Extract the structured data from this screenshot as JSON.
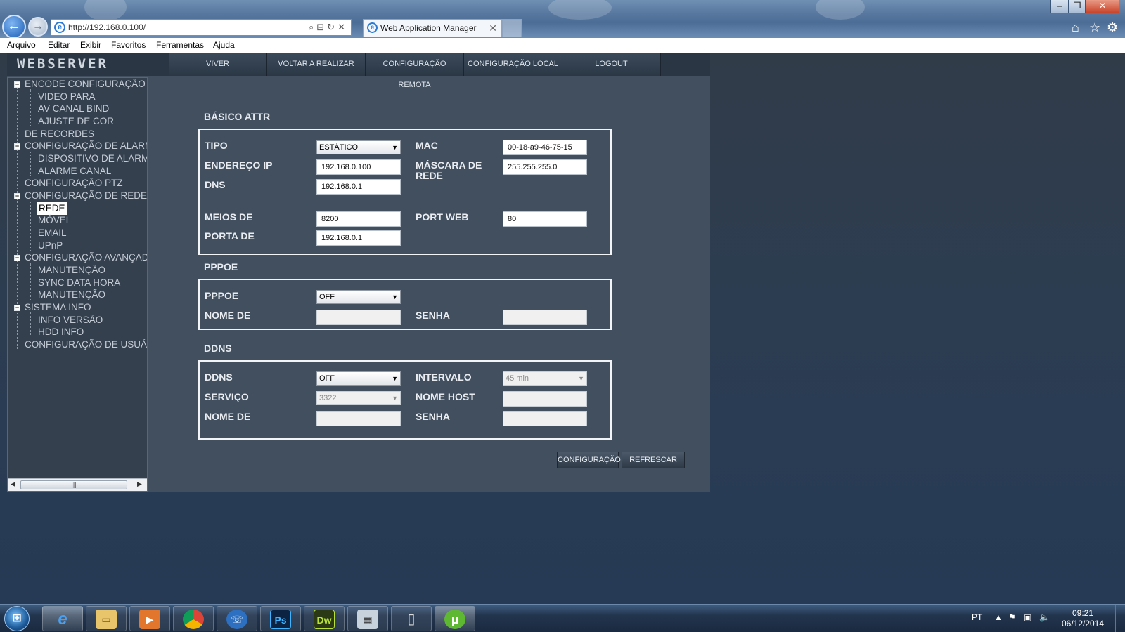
{
  "browser": {
    "address": "http://192.168.0.100/",
    "address_host": "192.168.0.100",
    "tab_title": "Web Application Manager",
    "window_controls": [
      "minimize-icon",
      "restore-icon",
      "close-icon"
    ],
    "menu": [
      "Arquivo",
      "Editar",
      "Exibir",
      "Favoritos",
      "Ferramentas",
      "Ajuda"
    ]
  },
  "app": {
    "logo": "WEBSERVER",
    "nav": [
      "VIVER",
      "VOLTAR A REALIZAR",
      "CONFIGURAÇÃO REMOTA",
      "CONFIGURAÇÃO LOCAL",
      "LOGOUT"
    ]
  },
  "tree": [
    {
      "label": "ENCODE CONFIGURAÇÃO",
      "level": 0,
      "toggle": true
    },
    {
      "label": "VIDEO PARA",
      "level": 1
    },
    {
      "label": "AV CANAL BIND",
      "level": 1
    },
    {
      "label": "AJUSTE DE COR",
      "level": 1
    },
    {
      "label": "DE RECORDES",
      "level": 0
    },
    {
      "label": "CONFIGURAÇÃO DE ALARM",
      "level": 0,
      "toggle": true
    },
    {
      "label": "DISPOSITIVO DE ALARM",
      "level": 1
    },
    {
      "label": "ALARME CANAL",
      "level": 1
    },
    {
      "label": "CONFIGURAÇÃO PTZ",
      "level": 0
    },
    {
      "label": "CONFIGURAÇÃO DE REDE",
      "level": 0,
      "toggle": true
    },
    {
      "label": "REDE",
      "level": 1,
      "selected": true
    },
    {
      "label": "MÓVEL",
      "level": 1
    },
    {
      "label": "EMAIL",
      "level": 1
    },
    {
      "label": "UPnP",
      "level": 1
    },
    {
      "label": "CONFIGURAÇÃO AVANÇAD",
      "level": 0,
      "toggle": true
    },
    {
      "label": "MANUTENÇÃO",
      "level": 1
    },
    {
      "label": "SYNC DATA HORA",
      "level": 1
    },
    {
      "label": "MANUTENÇÃO",
      "level": 1
    },
    {
      "label": "SISTEMA INFO",
      "level": 0,
      "toggle": true
    },
    {
      "label": "INFO VERSÃO",
      "level": 1
    },
    {
      "label": "HDD INFO",
      "level": 1
    },
    {
      "label": "CONFIGURAÇÃO DE USUÁ",
      "level": 0
    }
  ],
  "basic": {
    "title": "BÁSICO ATTR",
    "tipo_label": "TIPO",
    "tipo_value": "ESTÁTICO",
    "mac_label": "MAC",
    "mac_value": "00-18-a9-46-75-15",
    "ip_label": "ENDEREÇO IP",
    "ip_value": "192.168.0.100",
    "mask_label": "MÁSCARA DE REDE",
    "mask_value": "255.255.255.0",
    "dns_label": "DNS",
    "dns_value": "192.168.0.1",
    "media_label": "MEIOS DE",
    "media_value": "8200",
    "web_label": "PORT WEB",
    "web_value": "80",
    "gateway_label": "PORTA DE",
    "gateway_value": "192.168.0.1"
  },
  "pppoe": {
    "title": "PPPOE",
    "enable_label": "PPPOE",
    "enable_value": "OFF",
    "user_label": "NOME DE",
    "user_value": "",
    "pass_label": "SENHA",
    "pass_value": ""
  },
  "ddns": {
    "title": "DDNS",
    "enable_label": "DDNS",
    "enable_value": "OFF",
    "interval_label": "INTERVALO",
    "interval_value": "45 min",
    "service_label": "SERVIÇO",
    "service_value": "3322",
    "host_label": "NOME HOST",
    "host_value": "",
    "user_label": "NOME DE",
    "user_value": "",
    "pass_label": "SENHA",
    "pass_value": ""
  },
  "actions": {
    "save": "CONFIGURAÇÃO",
    "refresh": "REFRESCAR"
  },
  "taskbar": {
    "apps": [
      "internet-explorer-icon",
      "file-explorer-icon",
      "media-player-icon",
      "chrome-icon",
      "phone-app-icon",
      "photoshop-icon",
      "dreamweaver-icon",
      "calculator-icon",
      "usb-drive-icon",
      "utorrent-icon"
    ],
    "ps_label": "Ps",
    "dw_label": "Dw",
    "lang": "PT",
    "time": "09:21",
    "date": "06/12/2014"
  },
  "colors": {
    "page_bg": "#424f5e",
    "sidebar_bg": "#34404e",
    "desktop": "#2c3d52",
    "taskbar": "#1a2a40"
  }
}
